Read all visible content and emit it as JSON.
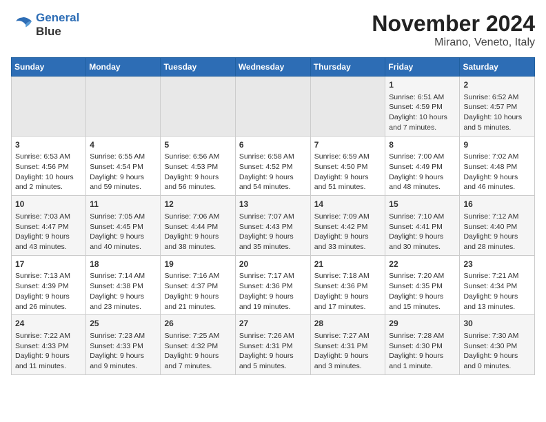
{
  "header": {
    "logo_line1": "General",
    "logo_line2": "Blue",
    "title": "November 2024",
    "subtitle": "Mirano, Veneto, Italy"
  },
  "weekdays": [
    "Sunday",
    "Monday",
    "Tuesday",
    "Wednesday",
    "Thursday",
    "Friday",
    "Saturday"
  ],
  "weeks": [
    [
      {
        "day": "",
        "info": ""
      },
      {
        "day": "",
        "info": ""
      },
      {
        "day": "",
        "info": ""
      },
      {
        "day": "",
        "info": ""
      },
      {
        "day": "",
        "info": ""
      },
      {
        "day": "1",
        "info": "Sunrise: 6:51 AM\nSunset: 4:59 PM\nDaylight: 10 hours and 7 minutes."
      },
      {
        "day": "2",
        "info": "Sunrise: 6:52 AM\nSunset: 4:57 PM\nDaylight: 10 hours and 5 minutes."
      }
    ],
    [
      {
        "day": "3",
        "info": "Sunrise: 6:53 AM\nSunset: 4:56 PM\nDaylight: 10 hours and 2 minutes."
      },
      {
        "day": "4",
        "info": "Sunrise: 6:55 AM\nSunset: 4:54 PM\nDaylight: 9 hours and 59 minutes."
      },
      {
        "day": "5",
        "info": "Sunrise: 6:56 AM\nSunset: 4:53 PM\nDaylight: 9 hours and 56 minutes."
      },
      {
        "day": "6",
        "info": "Sunrise: 6:58 AM\nSunset: 4:52 PM\nDaylight: 9 hours and 54 minutes."
      },
      {
        "day": "7",
        "info": "Sunrise: 6:59 AM\nSunset: 4:50 PM\nDaylight: 9 hours and 51 minutes."
      },
      {
        "day": "8",
        "info": "Sunrise: 7:00 AM\nSunset: 4:49 PM\nDaylight: 9 hours and 48 minutes."
      },
      {
        "day": "9",
        "info": "Sunrise: 7:02 AM\nSunset: 4:48 PM\nDaylight: 9 hours and 46 minutes."
      }
    ],
    [
      {
        "day": "10",
        "info": "Sunrise: 7:03 AM\nSunset: 4:47 PM\nDaylight: 9 hours and 43 minutes."
      },
      {
        "day": "11",
        "info": "Sunrise: 7:05 AM\nSunset: 4:45 PM\nDaylight: 9 hours and 40 minutes."
      },
      {
        "day": "12",
        "info": "Sunrise: 7:06 AM\nSunset: 4:44 PM\nDaylight: 9 hours and 38 minutes."
      },
      {
        "day": "13",
        "info": "Sunrise: 7:07 AM\nSunset: 4:43 PM\nDaylight: 9 hours and 35 minutes."
      },
      {
        "day": "14",
        "info": "Sunrise: 7:09 AM\nSunset: 4:42 PM\nDaylight: 9 hours and 33 minutes."
      },
      {
        "day": "15",
        "info": "Sunrise: 7:10 AM\nSunset: 4:41 PM\nDaylight: 9 hours and 30 minutes."
      },
      {
        "day": "16",
        "info": "Sunrise: 7:12 AM\nSunset: 4:40 PM\nDaylight: 9 hours and 28 minutes."
      }
    ],
    [
      {
        "day": "17",
        "info": "Sunrise: 7:13 AM\nSunset: 4:39 PM\nDaylight: 9 hours and 26 minutes."
      },
      {
        "day": "18",
        "info": "Sunrise: 7:14 AM\nSunset: 4:38 PM\nDaylight: 9 hours and 23 minutes."
      },
      {
        "day": "19",
        "info": "Sunrise: 7:16 AM\nSunset: 4:37 PM\nDaylight: 9 hours and 21 minutes."
      },
      {
        "day": "20",
        "info": "Sunrise: 7:17 AM\nSunset: 4:36 PM\nDaylight: 9 hours and 19 minutes."
      },
      {
        "day": "21",
        "info": "Sunrise: 7:18 AM\nSunset: 4:36 PM\nDaylight: 9 hours and 17 minutes."
      },
      {
        "day": "22",
        "info": "Sunrise: 7:20 AM\nSunset: 4:35 PM\nDaylight: 9 hours and 15 minutes."
      },
      {
        "day": "23",
        "info": "Sunrise: 7:21 AM\nSunset: 4:34 PM\nDaylight: 9 hours and 13 minutes."
      }
    ],
    [
      {
        "day": "24",
        "info": "Sunrise: 7:22 AM\nSunset: 4:33 PM\nDaylight: 9 hours and 11 minutes."
      },
      {
        "day": "25",
        "info": "Sunrise: 7:23 AM\nSunset: 4:33 PM\nDaylight: 9 hours and 9 minutes."
      },
      {
        "day": "26",
        "info": "Sunrise: 7:25 AM\nSunset: 4:32 PM\nDaylight: 9 hours and 7 minutes."
      },
      {
        "day": "27",
        "info": "Sunrise: 7:26 AM\nSunset: 4:31 PM\nDaylight: 9 hours and 5 minutes."
      },
      {
        "day": "28",
        "info": "Sunrise: 7:27 AM\nSunset: 4:31 PM\nDaylight: 9 hours and 3 minutes."
      },
      {
        "day": "29",
        "info": "Sunrise: 7:28 AM\nSunset: 4:30 PM\nDaylight: 9 hours and 1 minute."
      },
      {
        "day": "30",
        "info": "Sunrise: 7:30 AM\nSunset: 4:30 PM\nDaylight: 9 hours and 0 minutes."
      }
    ]
  ]
}
